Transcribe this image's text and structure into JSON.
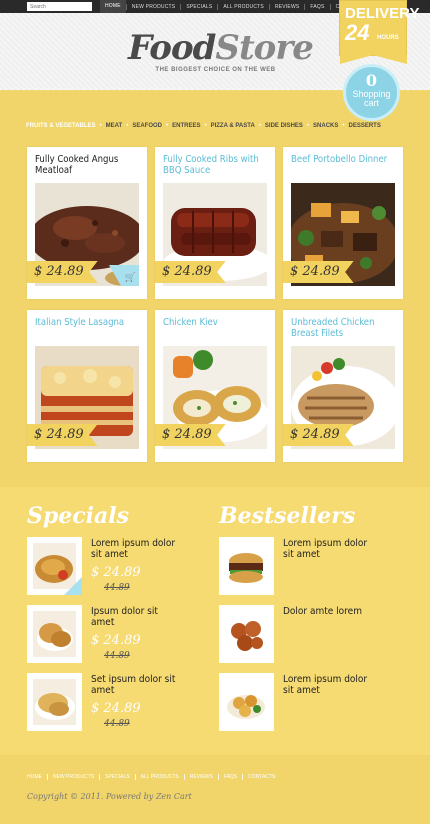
{
  "search": {
    "placeholder": "Search"
  },
  "top_nav": [
    "HOME",
    "NEW PRODUCTS",
    "SPECIALS",
    "ALL PRODUCTS",
    "REVIEWS",
    "FAQS",
    "CONTACTS"
  ],
  "logo": {
    "part1": "Food",
    "part2": "Store",
    "tagline": "THE BIGGEST CHOICE ON THE WEB"
  },
  "delivery": {
    "line1": "DELIVERY",
    "hours": "24",
    "hours_label": "HOURS"
  },
  "cart": {
    "count": "0",
    "line1": "Shopping",
    "line2": "cart"
  },
  "categories": [
    "FRUITS & VEGETABLES",
    "MEAT",
    "SEAFOOD",
    "ENTREES",
    "PIZZA & PASTA",
    "SIDE DISHES",
    "SNACKS",
    "DESSERTS"
  ],
  "products": [
    {
      "name": "Fully Cooked Angus Meatloaf",
      "price": "$ 24.89",
      "icon": "meatloaf"
    },
    {
      "name": "Fully Cooked Ribs with BBQ Sauce",
      "price": "$ 24.89",
      "icon": "ribs"
    },
    {
      "name": "Beef Portobello Dinner",
      "price": "$ 24.89",
      "icon": "beef-stew"
    },
    {
      "name": "Italian Style Lasagna",
      "price": "$ 24.89",
      "icon": "lasagna"
    },
    {
      "name": "Chicken Kiev",
      "price": "$ 24.89",
      "icon": "chicken-kiev"
    },
    {
      "name": "Unbreaded Chicken Breast Filets",
      "price": "$ 24.89",
      "icon": "chicken-breast"
    }
  ],
  "specials": {
    "title": "Specials",
    "items": [
      {
        "name": "Lorem ipsum dolor sit amet",
        "price": "$ 24.89",
        "old_price": "44.89"
      },
      {
        "name": "Ipsum dolor sit amet",
        "price": "$ 24.89",
        "old_price": "44.89"
      },
      {
        "name": "Set ipsum dolor sit amet",
        "price": "$ 24.89",
        "old_price": "44.89"
      }
    ]
  },
  "bestsellers": {
    "title": "Bestsellers",
    "items": [
      {
        "name": "Lorem ipsum dolor sit amet"
      },
      {
        "name": "Dolor amte lorem"
      },
      {
        "name": "Lorem ipsum dolor sit amet"
      }
    ]
  },
  "footer": {
    "nav": [
      "HOME",
      "NEW PRODUCTS",
      "SPECIALS",
      "ALL PRODUCTS",
      "REVIEWS",
      "FAQS",
      "CONTACTS"
    ],
    "copyright": "Copyright © 2011. Powered by Zen Cart"
  },
  "colors": {
    "accent_yellow": "#f3d35f",
    "accent_blue": "#5bbcd6",
    "topbar": "#2a2a2a"
  }
}
